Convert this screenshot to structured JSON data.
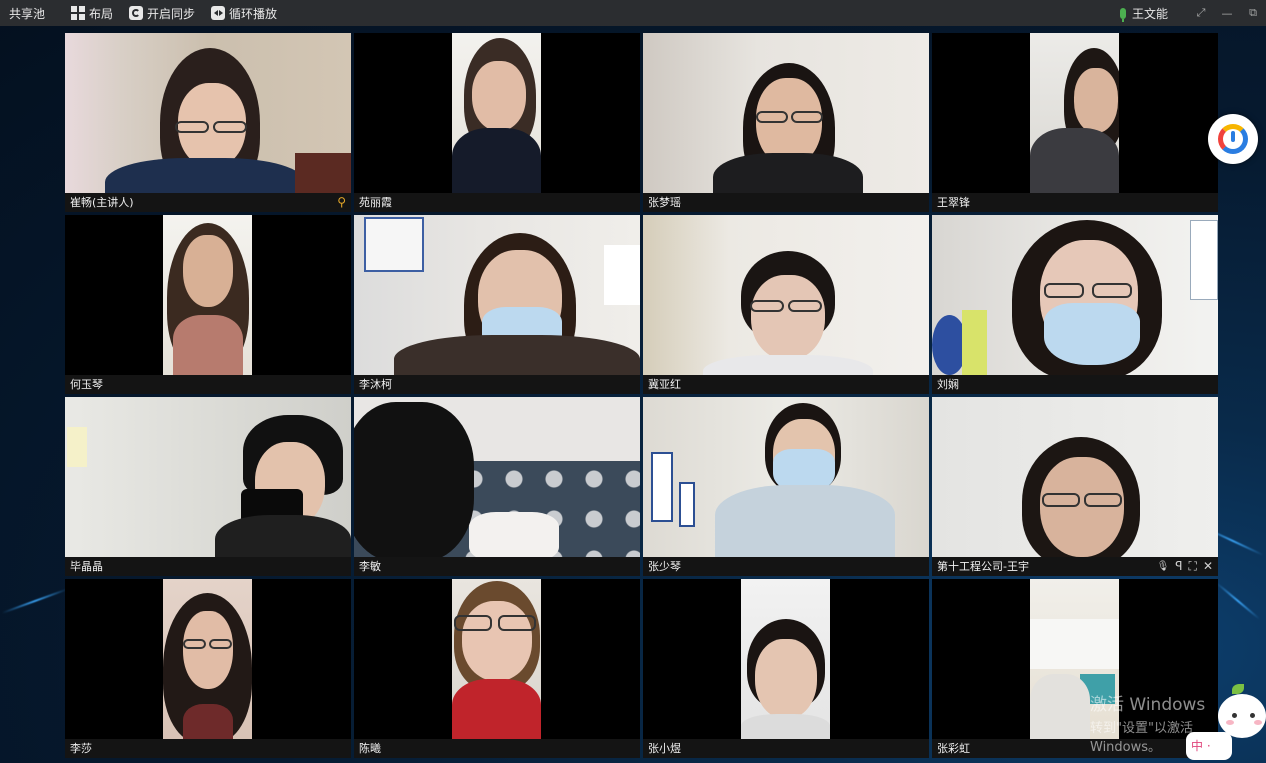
{
  "topbar": {
    "title": "共享池",
    "layout_label": "布局",
    "sync_label": "开启同步",
    "loop_label": "循环播放",
    "host_name": "王文能",
    "controls": {
      "expand": "⤢",
      "minimize": "—",
      "restore": "⧉"
    }
  },
  "participants": [
    {
      "name": "崔畅(主讲人)",
      "pinned": true
    },
    {
      "name": "苑丽霞"
    },
    {
      "name": "张梦瑶"
    },
    {
      "name": "王翠锋"
    },
    {
      "name": "何玉琴"
    },
    {
      "name": "李沐柯"
    },
    {
      "name": "冀亚红"
    },
    {
      "name": "刘娴"
    },
    {
      "name": "毕晶晶"
    },
    {
      "name": "李敏"
    },
    {
      "name": "张少琴"
    },
    {
      "name": "第十工程公司-王宇",
      "hover_controls": [
        "mute-mic",
        "pin",
        "fullscreen",
        "close"
      ]
    },
    {
      "name": "李莎"
    },
    {
      "name": "陈曦"
    },
    {
      "name": "张小煜"
    },
    {
      "name": "张彩虹"
    }
  ],
  "tile_icons": {
    "pin": "⚲",
    "mute": "🎙",
    "pin2": "ꟼ",
    "fullscreen": "⛶",
    "close": "✕"
  },
  "watermark": {
    "title": "激活 Windows",
    "subtitle": "转到\"设置\"以激活 Windows。"
  },
  "mascot": {
    "badge": "中 ·"
  },
  "colors": {
    "topbar": "#2b2d30",
    "caption": "#141414",
    "pin": "#e3a628",
    "mic": "#4caf50",
    "background": "#061a30"
  }
}
